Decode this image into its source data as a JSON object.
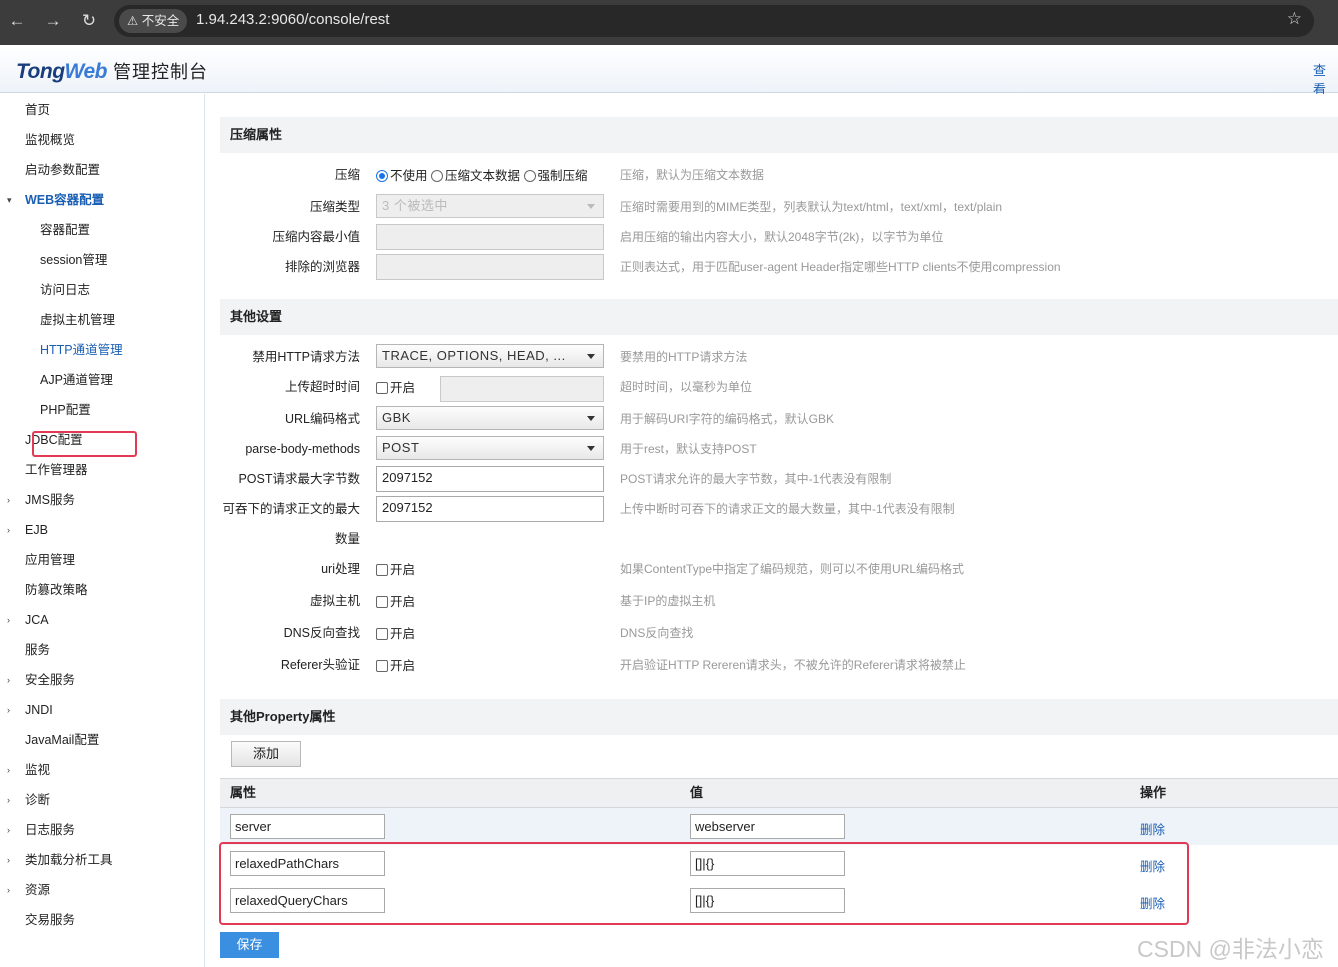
{
  "browser": {
    "insecure_label": "不安全",
    "url": "1.94.243.2:9060/console/rest"
  },
  "header": {
    "logo_tong": "Tong",
    "logo_web": "Web",
    "logo_cn": "管理控制台",
    "view_link": "查看"
  },
  "sidebar": {
    "items": [
      {
        "label": "首页",
        "level": 1,
        "arrow": ""
      },
      {
        "label": "监视概览",
        "level": 1,
        "arrow": ""
      },
      {
        "label": "启动参数配置",
        "level": 1,
        "arrow": ""
      },
      {
        "label": "WEB容器配置",
        "level": 1,
        "arrow": "▾",
        "state": "active"
      },
      {
        "label": "容器配置",
        "level": 2,
        "arrow": ""
      },
      {
        "label": "session管理",
        "level": 2,
        "arrow": ""
      },
      {
        "label": "访问日志",
        "level": 2,
        "arrow": ""
      },
      {
        "label": "虚拟主机管理",
        "level": 2,
        "arrow": ""
      },
      {
        "label": "HTTP通道管理",
        "level": 2,
        "arrow": "",
        "state": "cur"
      },
      {
        "label": "AJP通道管理",
        "level": 2,
        "arrow": ""
      },
      {
        "label": "PHP配置",
        "level": 2,
        "arrow": ""
      },
      {
        "label": "JDBC配置",
        "level": 1,
        "arrow": ""
      },
      {
        "label": "工作管理器",
        "level": 1,
        "arrow": ""
      },
      {
        "label": "JMS服务",
        "level": 1,
        "arrow": "›"
      },
      {
        "label": "EJB",
        "level": 1,
        "arrow": "›"
      },
      {
        "label": "应用管理",
        "level": 1,
        "arrow": ""
      },
      {
        "label": "防篡改策略",
        "level": 1,
        "arrow": ""
      },
      {
        "label": "JCA",
        "level": 1,
        "arrow": "›"
      },
      {
        "label": "服务",
        "level": 1,
        "arrow": ""
      },
      {
        "label": "安全服务",
        "level": 1,
        "arrow": "›"
      },
      {
        "label": "JNDI",
        "level": 1,
        "arrow": "›"
      },
      {
        "label": "JavaMail配置",
        "level": 1,
        "arrow": ""
      },
      {
        "label": "监视",
        "level": 1,
        "arrow": "›"
      },
      {
        "label": "诊断",
        "level": 1,
        "arrow": "›"
      },
      {
        "label": "日志服务",
        "level": 1,
        "arrow": "›"
      },
      {
        "label": "类加载分析工具",
        "level": 1,
        "arrow": "›"
      },
      {
        "label": "资源",
        "level": 1,
        "arrow": "›"
      },
      {
        "label": "交易服务",
        "level": 1,
        "arrow": ""
      }
    ]
  },
  "compression": {
    "title": "压缩属性",
    "compress_label": "压缩",
    "opt_off": "不使用",
    "opt_text": "压缩文本数据",
    "opt_force": "强制压缩",
    "compress_hint": "压缩，默认为压缩文本数据",
    "type_label": "压缩类型",
    "type_value": "3 个被选中",
    "type_hint": "压缩时需要用到的MIME类型，列表默认为text/html，text/xml，text/plain",
    "minsize_label": "压缩内容最小值",
    "minsize_hint": "启用压缩的输出内容大小，默认2048字节(2k)，以字节为单位",
    "exclude_label": "排除的浏览器",
    "exclude_hint": "正则表达式，用于匹配user-agent Header指定哪些HTTP clients不使用compression"
  },
  "other": {
    "title": "其他设置",
    "forbid_label": "禁用HTTP请求方法",
    "forbid_value": "TRACE, OPTIONS, HEAD, ...",
    "forbid_hint": "要禁用的HTTP请求方法",
    "timeout_label": "上传超时时间",
    "timeout_chk": "开启",
    "timeout_hint": "超时时间，以毫秒为单位",
    "urlenc_label": "URL编码格式",
    "urlenc_value": "GBK",
    "urlenc_hint": "用于解码URI字符的编码格式，默认GBK",
    "pbm_label": "parse-body-methods",
    "pbm_value": "POST",
    "pbm_hint": "用于rest，默认支持POST",
    "postmax_label": "POST请求最大字节数",
    "postmax_value": "2097152",
    "postmax_hint": "POST请求允许的最大字节数，其中-1代表没有限制",
    "swallow_label": "可吞下的请求正文的最大",
    "swallow_label2": "数量",
    "swallow_value": "2097152",
    "swallow_hint": "上传中断时可吞下的请求正文的最大数量，其中-1代表没有限制",
    "uri_label": "uri处理",
    "uri_chk": "开启",
    "uri_hint": "如果ContentType中指定了编码规范，则可以不使用URL编码格式",
    "vhost_label": "虚拟主机",
    "vhost_chk": "开启",
    "vhost_hint": "基于IP的虚拟主机",
    "dns_label": "DNS反向查找",
    "dns_chk": "开启",
    "dns_hint": "DNS反向查找",
    "referer_label": "Referer头验证",
    "referer_chk": "开启",
    "referer_hint": "开启验证HTTP Rereren请求头，不被允许的Referer请求将被禁止"
  },
  "props": {
    "title": "其他Property属性",
    "add_button": "添加",
    "col_attr": "属性",
    "col_value": "值",
    "col_op": "操作",
    "rows": [
      {
        "attr": "server",
        "value": "webserver",
        "op": "删除"
      },
      {
        "attr": "relaxedPathChars",
        "value": "[]|{}",
        "op": "删除"
      },
      {
        "attr": "relaxedQueryChars",
        "value": "[]|{}",
        "op": "删除"
      }
    ],
    "save_button": "保存"
  },
  "watermark": "CSDN @非法小恋"
}
